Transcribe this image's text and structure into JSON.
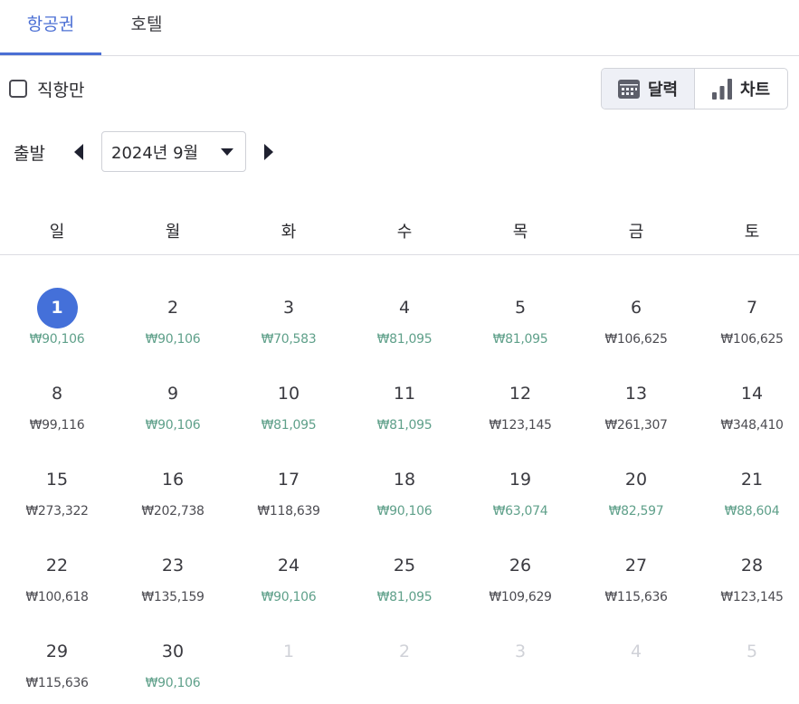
{
  "tabs": [
    {
      "label": "항공권",
      "active": true
    },
    {
      "label": "호텔",
      "active": false
    }
  ],
  "filters": {
    "direct_only_label": "직항만",
    "direct_only_checked": false
  },
  "view_toggle": {
    "calendar_label": "달력",
    "chart_label": "차트",
    "active": "calendar"
  },
  "departure": {
    "label": "출발",
    "month": "2024년 9월"
  },
  "weekdays": [
    "일",
    "월",
    "화",
    "수",
    "목",
    "금",
    "토"
  ],
  "days": [
    {
      "day": "1",
      "price": "₩90,106",
      "level": "low",
      "selected": true
    },
    {
      "day": "2",
      "price": "₩90,106",
      "level": "low"
    },
    {
      "day": "3",
      "price": "₩70,583",
      "level": "low"
    },
    {
      "day": "4",
      "price": "₩81,095",
      "level": "low"
    },
    {
      "day": "5",
      "price": "₩81,095",
      "level": "low"
    },
    {
      "day": "6",
      "price": "₩106,625",
      "level": "high"
    },
    {
      "day": "7",
      "price": "₩106,625",
      "level": "high"
    },
    {
      "day": "8",
      "price": "₩99,116",
      "level": "high"
    },
    {
      "day": "9",
      "price": "₩90,106",
      "level": "low"
    },
    {
      "day": "10",
      "price": "₩81,095",
      "level": "low"
    },
    {
      "day": "11",
      "price": "₩81,095",
      "level": "low"
    },
    {
      "day": "12",
      "price": "₩123,145",
      "level": "high"
    },
    {
      "day": "13",
      "price": "₩261,307",
      "level": "high"
    },
    {
      "day": "14",
      "price": "₩348,410",
      "level": "high"
    },
    {
      "day": "15",
      "price": "₩273,322",
      "level": "high"
    },
    {
      "day": "16",
      "price": "₩202,738",
      "level": "high"
    },
    {
      "day": "17",
      "price": "₩118,639",
      "level": "high"
    },
    {
      "day": "18",
      "price": "₩90,106",
      "level": "low"
    },
    {
      "day": "19",
      "price": "₩63,074",
      "level": "low"
    },
    {
      "day": "20",
      "price": "₩82,597",
      "level": "low"
    },
    {
      "day": "21",
      "price": "₩88,604",
      "level": "low"
    },
    {
      "day": "22",
      "price": "₩100,618",
      "level": "high"
    },
    {
      "day": "23",
      "price": "₩135,159",
      "level": "high"
    },
    {
      "day": "24",
      "price": "₩90,106",
      "level": "low"
    },
    {
      "day": "25",
      "price": "₩81,095",
      "level": "low"
    },
    {
      "day": "26",
      "price": "₩109,629",
      "level": "high"
    },
    {
      "day": "27",
      "price": "₩115,636",
      "level": "high"
    },
    {
      "day": "28",
      "price": "₩123,145",
      "level": "high"
    },
    {
      "day": "29",
      "price": "₩115,636",
      "level": "high"
    },
    {
      "day": "30",
      "price": "₩90,106",
      "level": "low"
    }
  ],
  "next_month_days": [
    "1",
    "2",
    "3",
    "4",
    "5"
  ],
  "colors": {
    "accent": "#4b6fd4",
    "selected_day": "#4470d9",
    "price_low": "#5fa08a",
    "price_high": "#4c4c52"
  },
  "icons": {
    "calendar": "calendar-icon",
    "chart": "bar-chart-icon",
    "prev": "triangle-left-icon",
    "next": "triangle-right-icon",
    "dropdown": "caret-down-icon"
  }
}
